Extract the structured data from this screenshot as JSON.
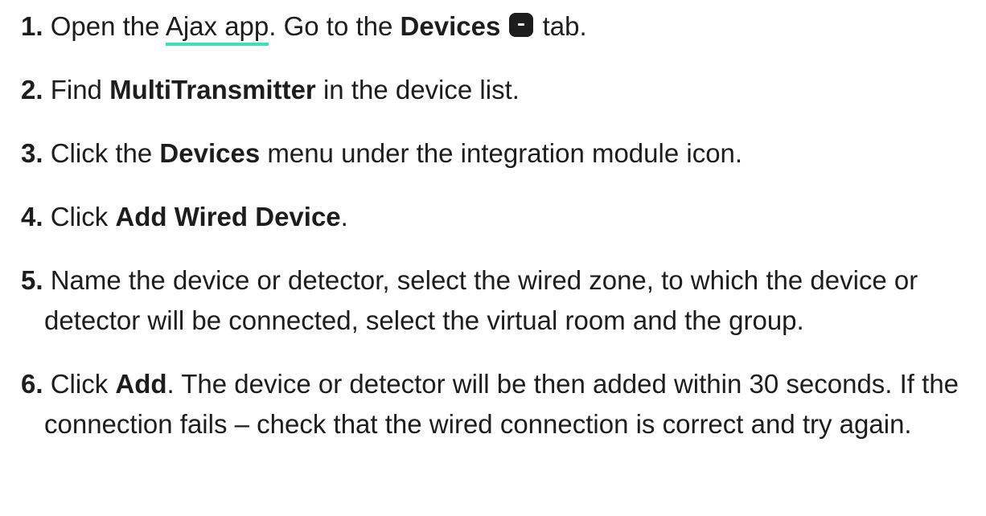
{
  "steps": [
    {
      "num": "1.",
      "t1": "Open the ",
      "link": "Ajax app",
      "t2": ". Go to the ",
      "b1": "Devices",
      "icon": "devices-tab-icon",
      "t3": " tab."
    },
    {
      "num": "2.",
      "t1": "Find ",
      "b1": "MultiTransmitter",
      "t2": " in the device list."
    },
    {
      "num": "3.",
      "t1": "Click the ",
      "b1": "Devices",
      "t2": " menu under the integration module icon."
    },
    {
      "num": "4.",
      "t1": "Click ",
      "b1": "Add Wired Device",
      "t2": "."
    },
    {
      "num": "5.",
      "t1": "Name the device or detector, select the wired zone, to which the device or detector will be connected, select the virtual room and the group."
    },
    {
      "num": "6.",
      "t1": "Click ",
      "b1": "Add",
      "t2": ". The device or detector will be then added within 30 seconds. If the connection fails – check that the wired connection is correct and try again."
    }
  ],
  "colors": {
    "text": "#1d1d1d",
    "link_underline": "#3ee0b5",
    "background": "#ffffff"
  }
}
